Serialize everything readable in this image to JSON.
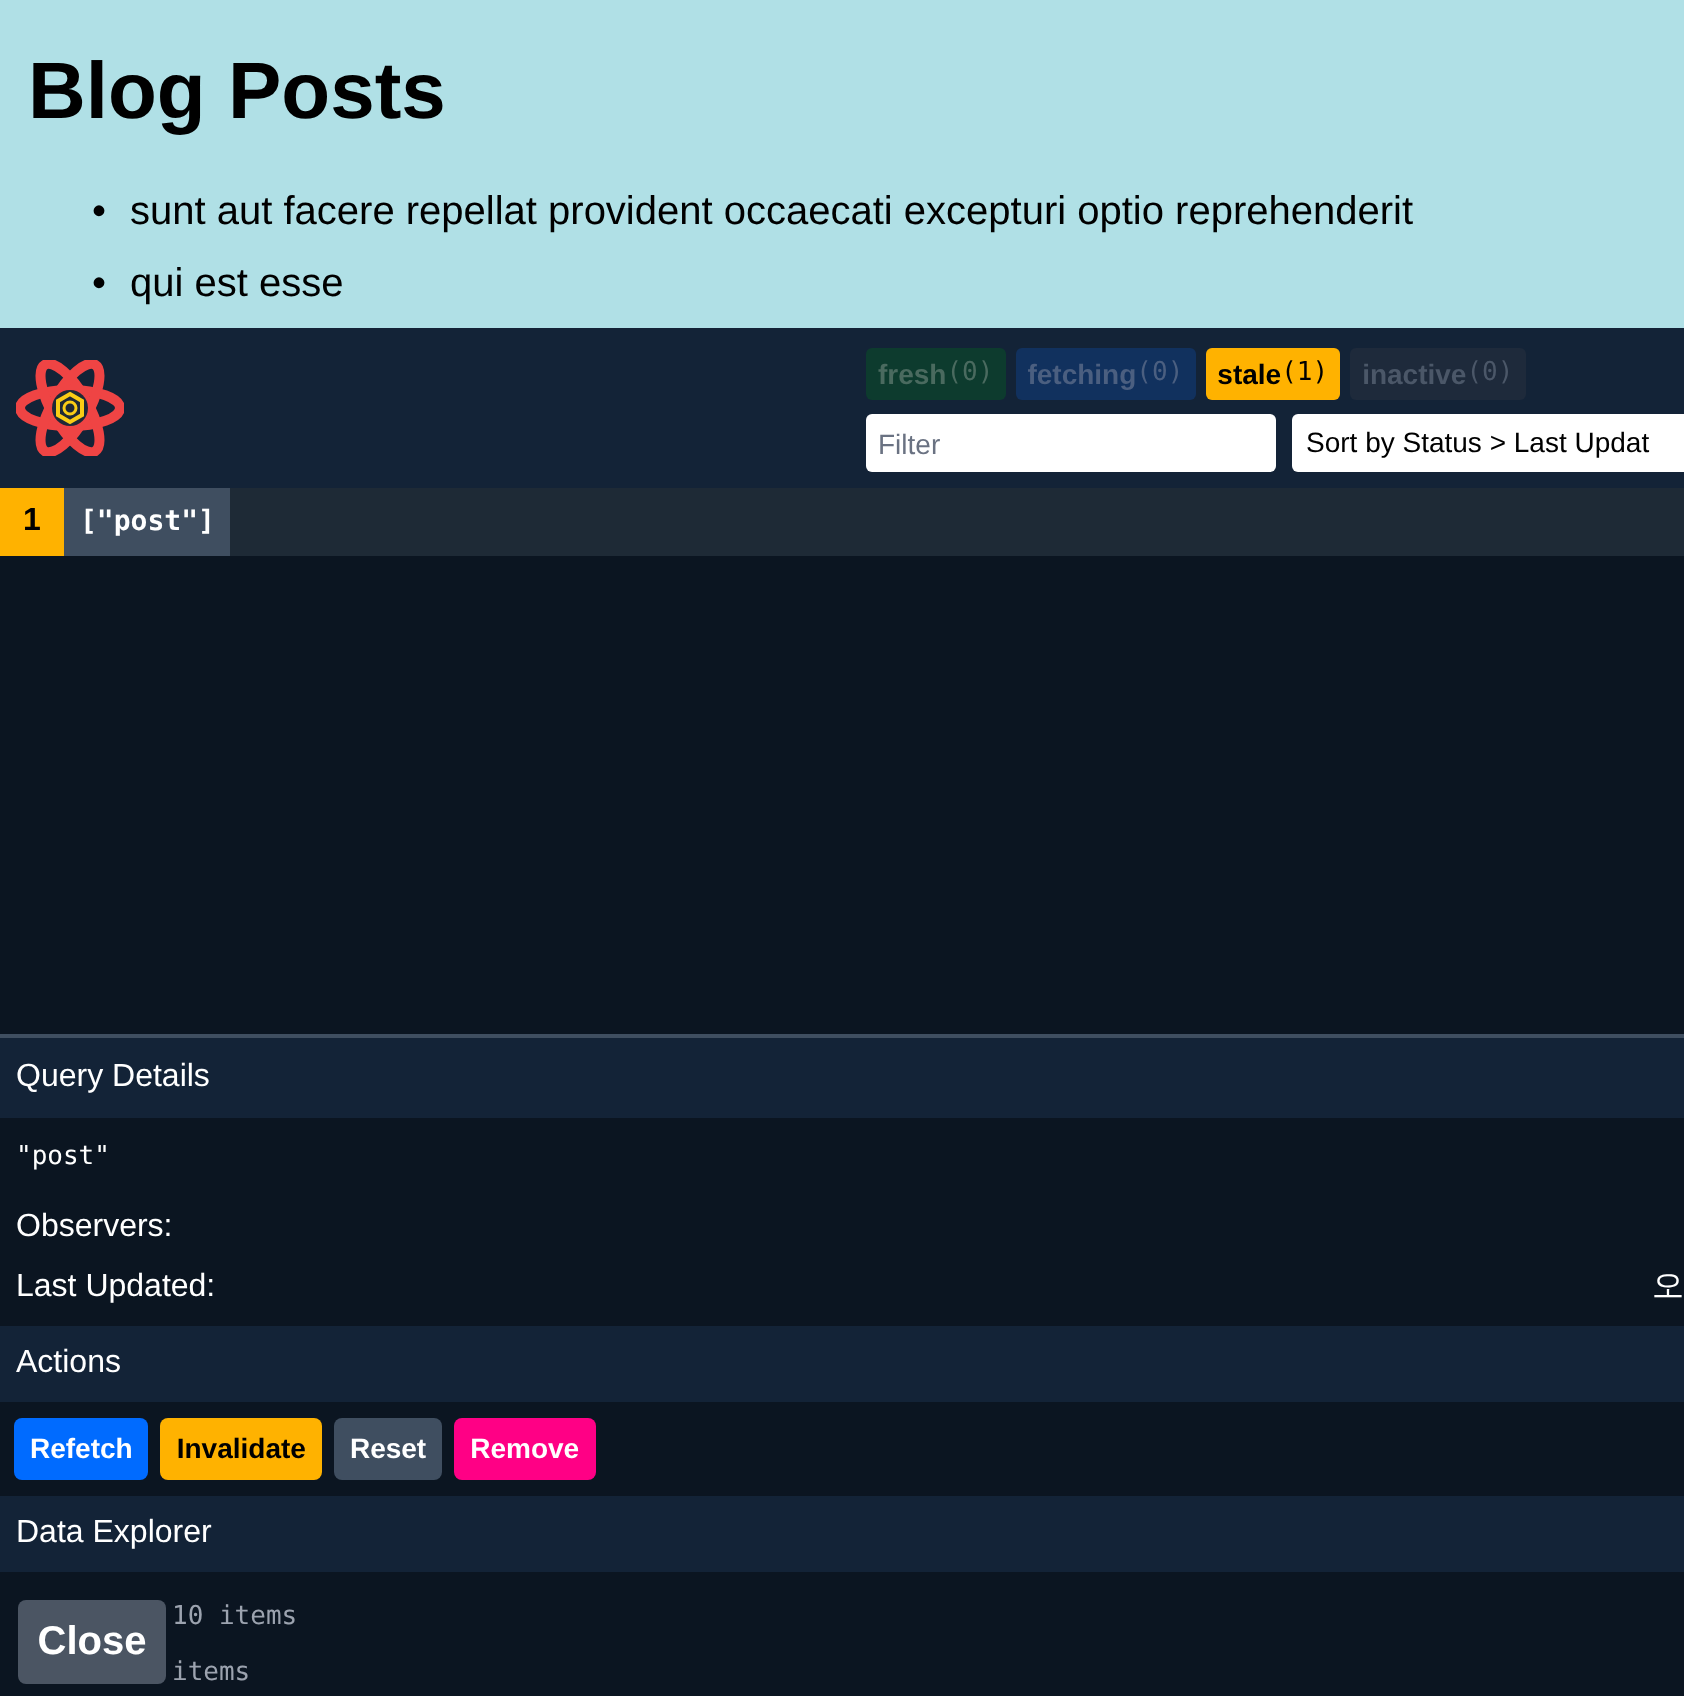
{
  "page": {
    "heading": "Blog Posts",
    "posts": [
      {
        "marker": "•",
        "title": "sunt aut facere repellat provident occaecati excepturi optio reprehenderit"
      },
      {
        "marker": "•",
        "title": "qui est esse"
      }
    ]
  },
  "devtools": {
    "status_badges": [
      {
        "kind": "fresh",
        "label": "fresh",
        "count": "(0)",
        "active": false
      },
      {
        "kind": "fetching",
        "label": "fetching",
        "count": "(0)",
        "active": false
      },
      {
        "kind": "stale",
        "label": "stale",
        "count": "(1)",
        "active": true
      },
      {
        "kind": "inactive",
        "label": "inactive",
        "count": "(0)",
        "active": false
      }
    ],
    "filter": {
      "placeholder": "Filter"
    },
    "sort": {
      "value": "Sort by Status > Last Updat"
    },
    "queries": [
      {
        "observers": "1",
        "key": "[\"post\"]",
        "selected": false
      }
    ],
    "query_details": {
      "title": "Query Details",
      "key": "\"post\"",
      "observers_label": "Observers:",
      "last_updated_label": "Last Updated:",
      "last_updated_value": "오"
    },
    "actions": {
      "title": "Actions",
      "buttons": [
        {
          "kind": "refetch",
          "label": "Refetch"
        },
        {
          "kind": "invalidate",
          "label": "Invalidate"
        },
        {
          "kind": "reset",
          "label": "Reset"
        },
        {
          "kind": "remove",
          "label": "Remove"
        }
      ]
    },
    "data_explorer": {
      "title": "Data Explorer",
      "rows": [
        "10 items",
        "items"
      ]
    },
    "close_button": "Close"
  }
}
